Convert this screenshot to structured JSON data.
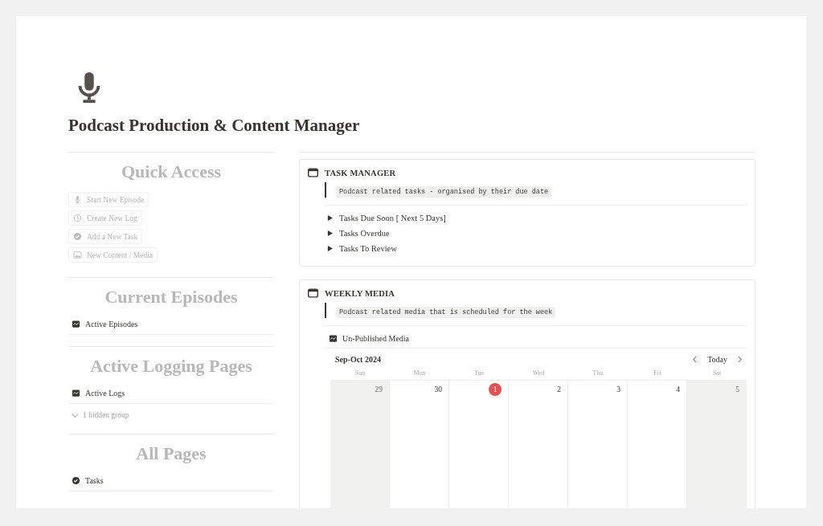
{
  "page": {
    "title": "Podcast Production & Content Manager"
  },
  "sidebar": [
    {
      "heading": "Quick Access",
      "items": [
        {
          "kind": "button",
          "label": "Start New Episode"
        },
        {
          "kind": "button",
          "label": "Create New Log"
        },
        {
          "kind": "button",
          "label": "Add a New Task"
        },
        {
          "kind": "button",
          "label": "New Content / Media"
        }
      ]
    },
    {
      "heading": "Current Episodes",
      "items": [
        {
          "kind": "view_link",
          "label": "Active Episodes"
        }
      ]
    },
    {
      "heading": "Active Logging Pages",
      "items": [
        {
          "kind": "view_link",
          "label": "Active Logs"
        },
        {
          "kind": "hidden_group",
          "label": "1 hidden group"
        }
      ]
    },
    {
      "heading": "All Pages",
      "items": [
        {
          "kind": "page_link",
          "label": "Tasks"
        }
      ]
    }
  ],
  "task_manager": {
    "title": "TASK MANAGER",
    "description": "Podcast related tasks - organised by their due date",
    "toggles": [
      {
        "label": "Tasks Due Soon [ Next 5 Days]",
        "expanded": false
      },
      {
        "label": "Tasks Overdue",
        "expanded": false
      },
      {
        "label": "Tasks To Review",
        "expanded": false
      }
    ]
  },
  "weekly_media": {
    "title": "WEEKLY MEDIA",
    "description": "Podcast related media that is scheduled for the week",
    "view": "Un-Published Media",
    "calendar": {
      "range": "Sep-Oct 2024",
      "today_button": "Today",
      "weekdays": [
        "Sun",
        "Mon",
        "Tue",
        "Wed",
        "Thu",
        "Fri",
        "Sat"
      ],
      "days": [
        {
          "label": "29",
          "weekend": true,
          "today": false
        },
        {
          "label": "30",
          "weekend": false,
          "today": false
        },
        {
          "label": "1",
          "weekend": false,
          "today": true
        },
        {
          "label": "2",
          "weekend": false,
          "today": false
        },
        {
          "label": "3",
          "weekend": false,
          "today": false
        },
        {
          "label": "4",
          "weekend": false,
          "today": false
        },
        {
          "label": "5",
          "weekend": true,
          "today": false
        }
      ]
    }
  }
}
